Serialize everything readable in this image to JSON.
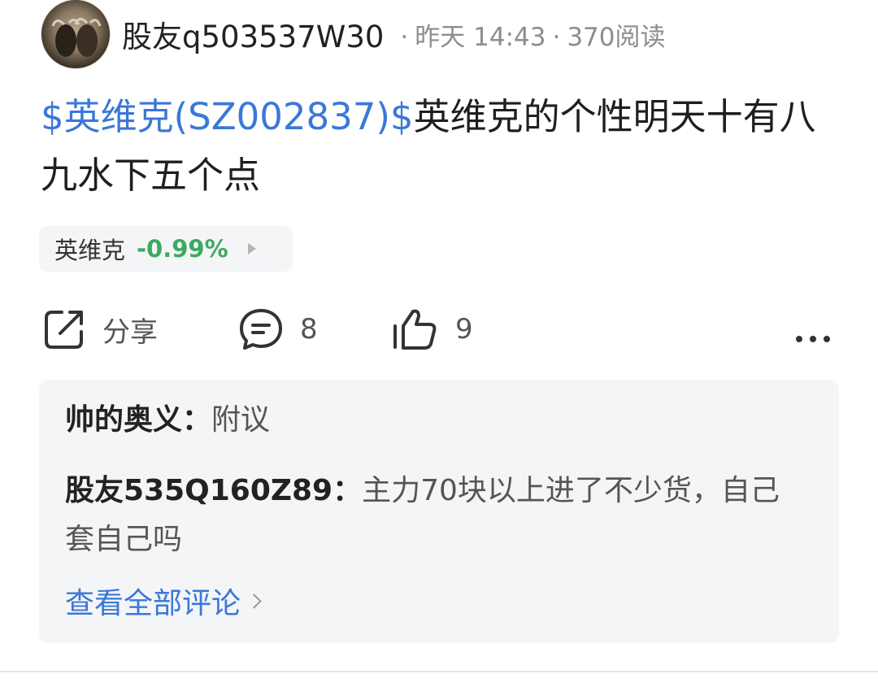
{
  "post": {
    "author": "股友q503537W30",
    "time": "昨天 14:43",
    "reads": "370阅读",
    "stock_tag": "$英维克(SZ002837)$",
    "content": "英维克的个性明天十有八九水下五个点",
    "chip": {
      "name": "英维克",
      "change": "-0.99%"
    }
  },
  "actions": {
    "share_label": "分享",
    "comment_count": "8",
    "like_count": "9"
  },
  "comments": [
    {
      "user": "帅的奥义",
      "sep": "：",
      "text": "附议"
    },
    {
      "user": "股友535Q160Z89",
      "sep": "：",
      "text": "主力70块以上进了不少货，自己套自己吗"
    }
  ],
  "view_all_label": "查看全部评论",
  "colors": {
    "link": "#3a78d8",
    "down": "#3caa5f",
    "panel": "#f4f5f7"
  }
}
